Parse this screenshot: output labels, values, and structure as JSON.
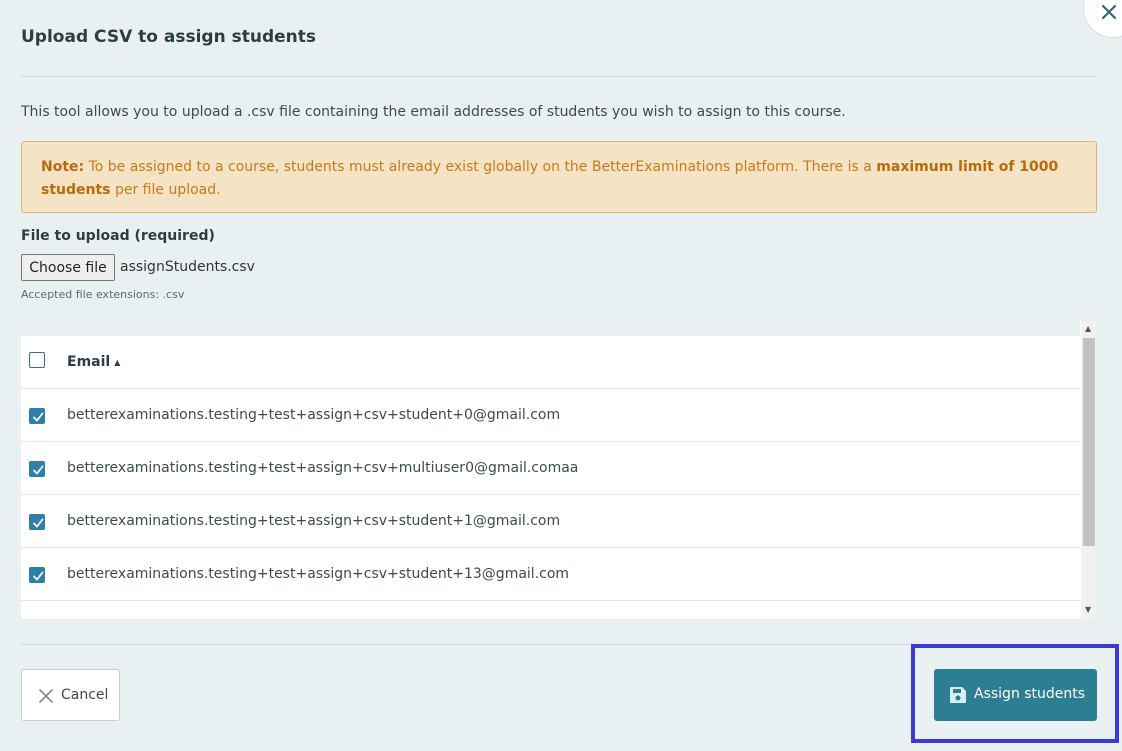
{
  "dialog": {
    "title": "Upload CSV to assign students",
    "close_icon": "close-icon",
    "intro": "This tool allows you to upload a .csv file containing the email addresses of students you wish to assign to this course.",
    "note": {
      "label": "Note:",
      "text_before": " To be assigned to a course, students must already exist globally on the BetterExaminations platform. There is a ",
      "emphasis": "maximum limit of 1000 students",
      "text_after": " per file upload."
    },
    "file": {
      "label": "File to upload (required)",
      "choose_button": "Choose file",
      "selected_name": "assignStudents.csv",
      "accepted": "Accepted file extensions: .csv"
    },
    "table": {
      "header": "Email",
      "sort_icon": "sort-asc-icon",
      "header_checked": false,
      "rows": [
        {
          "email": "betterexaminations.testing+test+assign+csv+student+0@gmail.com",
          "checked": true
        },
        {
          "email": "betterexaminations.testing+test+assign+csv+multiuser0@gmail.comaa",
          "checked": true
        },
        {
          "email": "betterexaminations.testing+test+assign+csv+student+1@gmail.com",
          "checked": true
        },
        {
          "email": "betterexaminations.testing+test+assign+csv+student+13@gmail.com",
          "checked": true
        }
      ]
    },
    "footer": {
      "cancel_label": "Cancel",
      "cancel_icon": "close-icon",
      "assign_label": "Assign students",
      "assign_icon": "save-icon"
    }
  },
  "colors": {
    "background": "#e9f0f1",
    "accent": "#2d7d93",
    "note_bg": "#f4e3c5",
    "note_text": "#c97a17",
    "highlight": "#3a3bd0"
  }
}
